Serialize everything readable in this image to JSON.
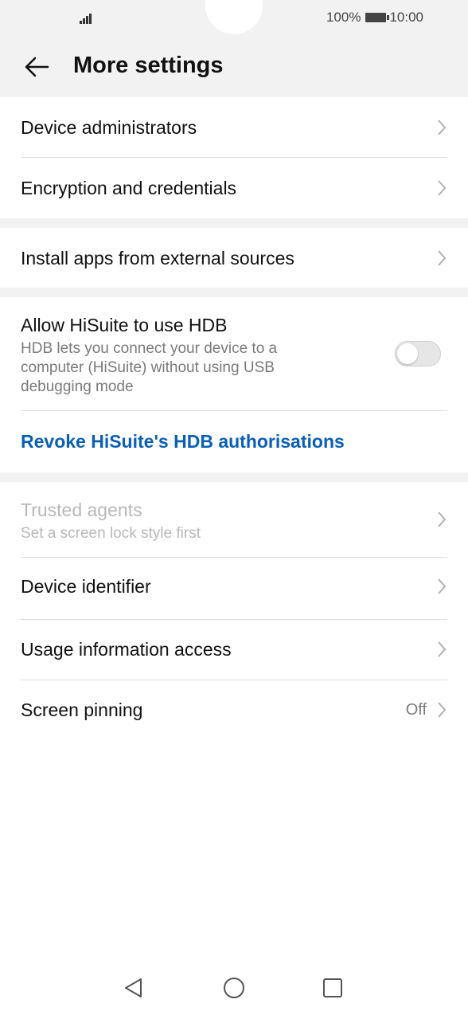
{
  "status_bar": {
    "battery_text": "100%",
    "time": "10:00"
  },
  "header": {
    "title": "More settings",
    "back_icon": "arrow-left-icon"
  },
  "items": {
    "device_administrators": {
      "label": "Device administrators"
    },
    "encryption": {
      "label": "Encryption and credentials"
    },
    "install_apps": {
      "label": "Install apps from external sources"
    },
    "hdb": {
      "label": "Allow HiSuite to use HDB",
      "description_lines": [
        "HDB lets you connect your device to a",
        "computer (HiSuite) without using USB",
        "debugging mode"
      ],
      "toggle_on": false
    },
    "revoke": {
      "label": "Revoke HiSuite's HDB authorisations"
    },
    "trusted_agents": {
      "label": "Trusted agents",
      "sub": "Set a screen lock style first"
    },
    "device_identifier": {
      "label": "Device identifier"
    },
    "usage_access": {
      "label": "Usage information access"
    },
    "screen_pinning": {
      "label": "Screen pinning",
      "value": "Off"
    }
  },
  "colors": {
    "accent_link": "#0b5fb5",
    "background_gap": "#f2f2f2"
  },
  "nav_icons": [
    "back-triangle-icon",
    "home-circle-icon",
    "recents-square-icon"
  ]
}
